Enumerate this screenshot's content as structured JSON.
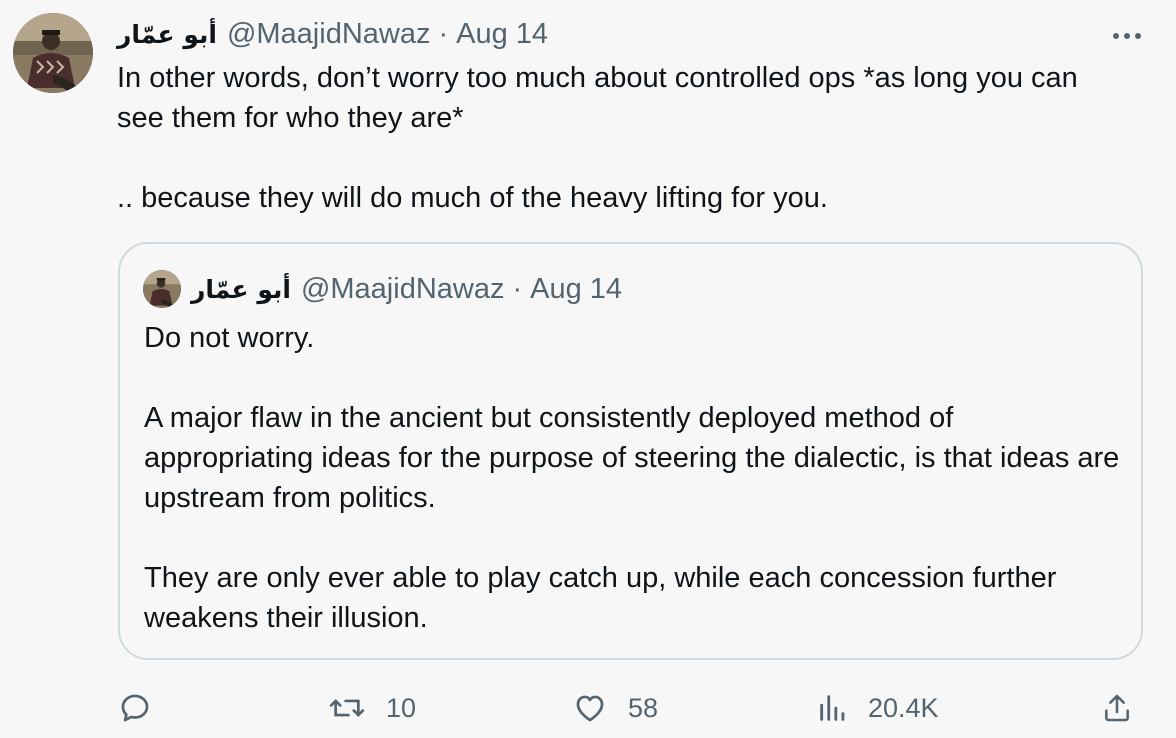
{
  "tweet": {
    "display_name": "أبو عمّار",
    "handle": "@MaajidNawaz",
    "separator": "·",
    "date": "Aug 14",
    "text_lines": [
      "In other words, don’t worry too much about controlled ops *as long you can see them for who they are*",
      ".. because they will do much of the heavy lifting for you."
    ],
    "more_icon": "more-horizontal-icon"
  },
  "quote": {
    "display_name": "أبو عمّار",
    "handle": "@MaajidNawaz",
    "separator": "·",
    "date": "Aug 14",
    "paragraphs": [
      "Do not worry.",
      "A major flaw in the ancient but consistently deployed method of appropriating ideas for the purpose of steering the dialectic, is that ideas are upstream from politics.",
      "They are only ever able to play catch up, while each concession further weakens their illusion."
    ]
  },
  "actions": {
    "reply": {
      "icon": "reply-icon",
      "count": ""
    },
    "retweet": {
      "icon": "retweet-icon",
      "count": "10"
    },
    "like": {
      "icon": "heart-icon",
      "count": "58"
    },
    "views": {
      "icon": "views-chart-icon",
      "count": "20.4K"
    },
    "share": {
      "icon": "share-icon",
      "count": ""
    }
  },
  "colors": {
    "background": "#f7f7f7",
    "text": "#0f1419",
    "secondary": "#536471",
    "border": "#cfd9de"
  }
}
